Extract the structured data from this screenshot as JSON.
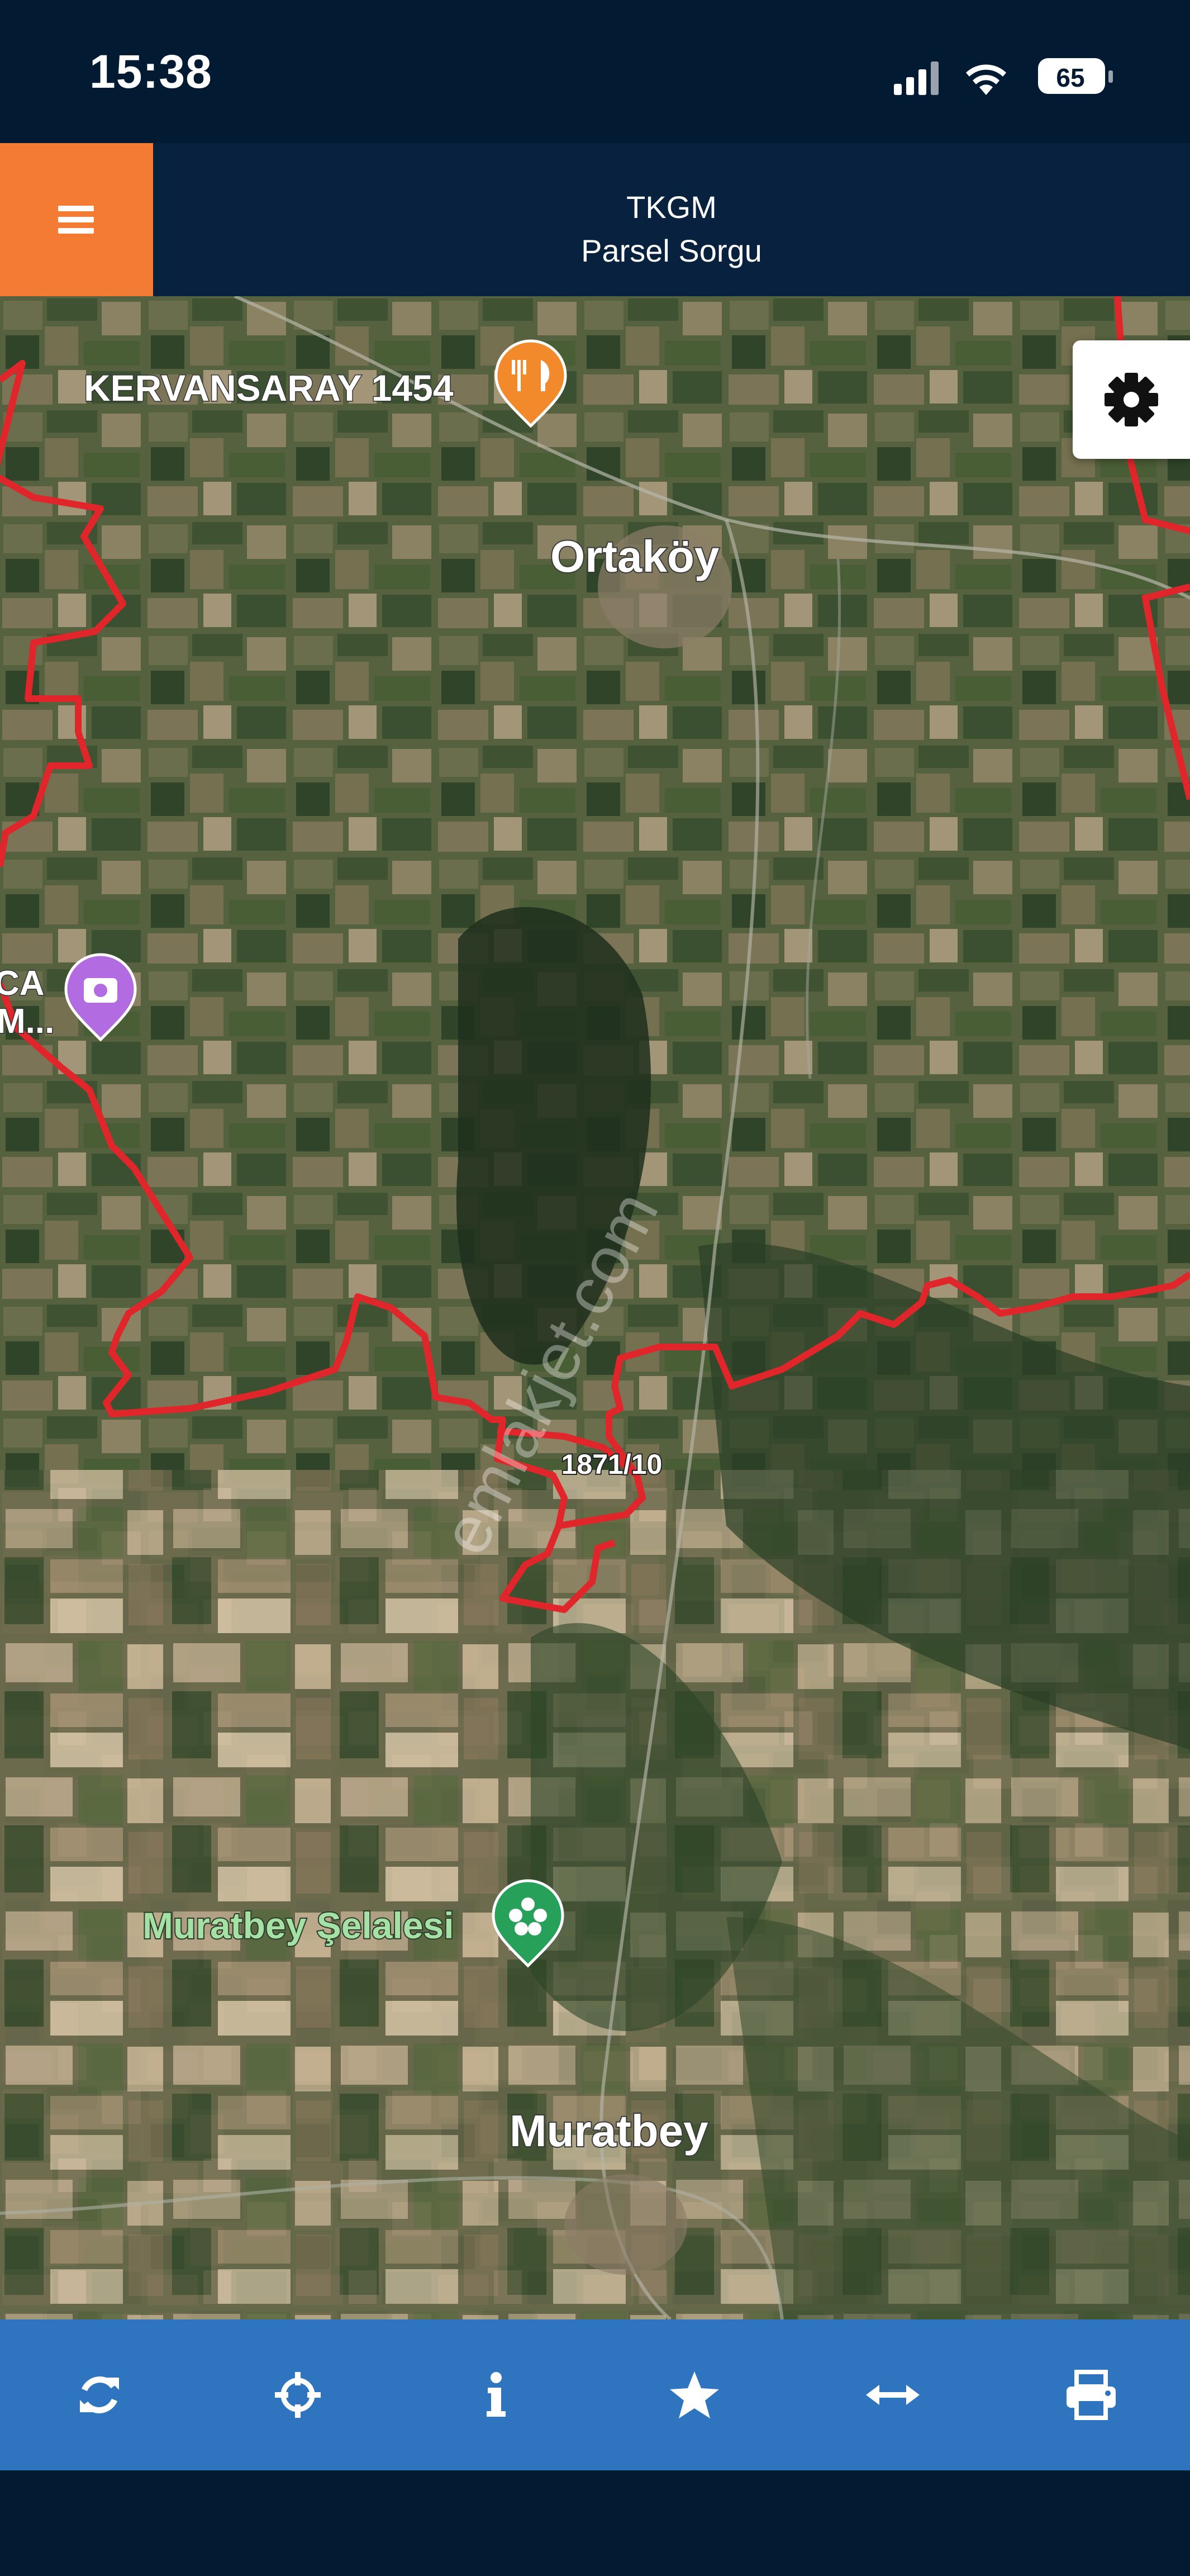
{
  "status_bar": {
    "time": "15:38",
    "battery": "65"
  },
  "header": {
    "title": "TKGM",
    "subtitle": "Parsel Sorgu",
    "menu_icon": "hamburger-icon"
  },
  "map": {
    "places": {
      "kervansaray": "KERVANSARAY 1454",
      "ortakoy": "Ortaköy",
      "muratbey_selalesi": "Muratbey Şelalesi",
      "muratbey": "Muratbey",
      "partial_top": "CA",
      "partial_bottom": "M..."
    },
    "parcel_label": "1871/10",
    "watermark": "emlakjet.com",
    "parcel_border_color": "#e0262b",
    "settings_icon": "gear-icon"
  },
  "toolbar": {
    "items": [
      {
        "icon": "refresh-icon"
      },
      {
        "icon": "crosshair-icon"
      },
      {
        "icon": "info-icon"
      },
      {
        "icon": "star-icon"
      },
      {
        "icon": "measure-icon"
      },
      {
        "icon": "print-icon"
      }
    ]
  }
}
